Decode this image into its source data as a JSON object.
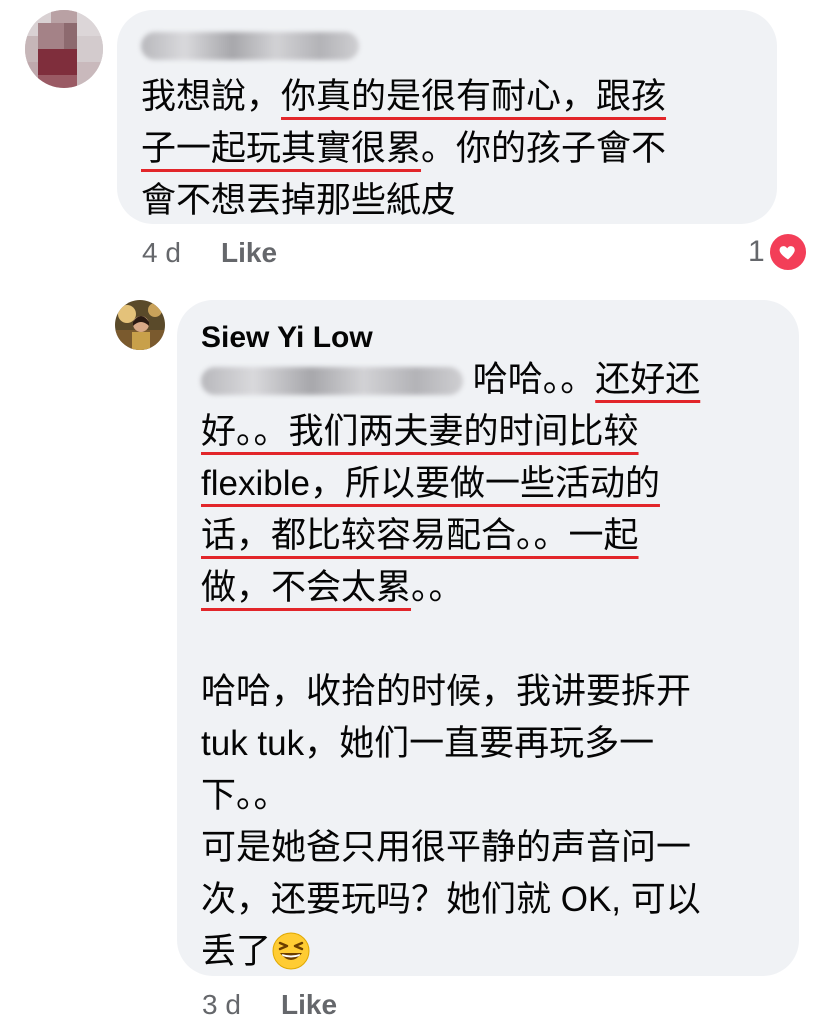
{
  "comment": {
    "author_name": "Lee Shing Tee",
    "lines": [
      "我想說，",
      "你真的是很有耐心，跟孩",
      "子一起玩其實很累",
      "。你的孩子會不",
      "會不想丟掉那些紙皮"
    ],
    "time": "4 d",
    "like_label": "Like",
    "reaction_count": "1",
    "reaction_icon": "heart-icon",
    "reaction_color": "#f33e58"
  },
  "reply": {
    "author_name": "Siew Yi Low",
    "mention": "Lee Shing Tee",
    "lines": [
      " 哈哈。。",
      "还好还",
      "好。",
      "。我们两夫妻的时间比较",
      "flexible，所以要做一些活动的",
      "话，都比较容易配合。",
      "。一起",
      "做，不会太累",
      "。。",
      "",
      "哈哈，收拾的时候，我讲要拆开",
      "tuk tuk，她们一直要再玩多一",
      "下。。",
      "可是她爸只用很平静的声音问一",
      "次，还要玩吗？她们就 OK, 可以",
      "丢了"
    ],
    "emoji": "grinning-squinting-face-icon",
    "time": "3 d",
    "like_label": "Like"
  },
  "colors": {
    "bubble": "#f0f2f5",
    "meta": "#65676b",
    "underline": "#e2262a"
  }
}
